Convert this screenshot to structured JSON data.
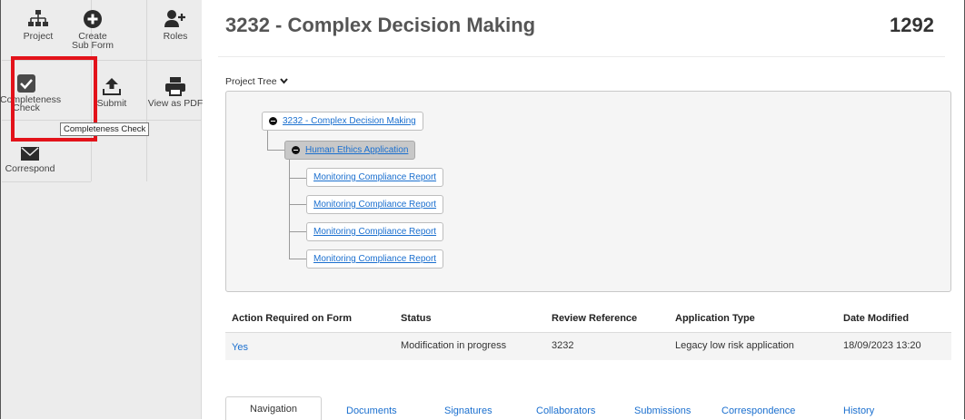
{
  "header": {
    "title": "3232 - Complex Decision Making",
    "project_number": "1292"
  },
  "toolbar": {
    "row1": [
      {
        "label": "Project",
        "icon": "sitemap-icon"
      },
      {
        "label": "Create Sub Form",
        "icon": "plus-circle-icon"
      },
      {
        "label": "Roles",
        "icon": "user-plus-icon"
      }
    ],
    "row2": [
      {
        "label": "Completeness Check",
        "icon": "checkbox-checked-icon"
      },
      {
        "label": "Submit",
        "icon": "upload-icon"
      },
      {
        "label": "View as PDF",
        "icon": "printer-icon"
      }
    ],
    "row3": [
      {
        "label": "Correspond",
        "icon": "envelope-icon"
      }
    ],
    "tooltip": "Completeness Check",
    "highlight_color": "#e3121a"
  },
  "tree": {
    "label": "Project Tree",
    "root": "3232 - Complex Decision Making",
    "child": "Human Ethics Application",
    "reports": [
      "Monitoring Compliance Report",
      "Monitoring Compliance Report",
      "Monitoring Compliance Report",
      "Monitoring Compliance Report"
    ]
  },
  "table": {
    "headers": [
      "Action Required on Form",
      "Status",
      "Review Reference",
      "Application Type",
      "Date Modified"
    ],
    "row": [
      "Yes",
      "Modification in progress",
      "3232",
      "Legacy low risk application",
      "18/09/2023 13:20"
    ]
  },
  "tabs": [
    "Navigation",
    "Documents",
    "Signatures",
    "Collaborators",
    "Submissions",
    "Correspondence",
    "History"
  ],
  "colors": {
    "link": "#1a6fcf",
    "sidebar": "#ececec"
  }
}
